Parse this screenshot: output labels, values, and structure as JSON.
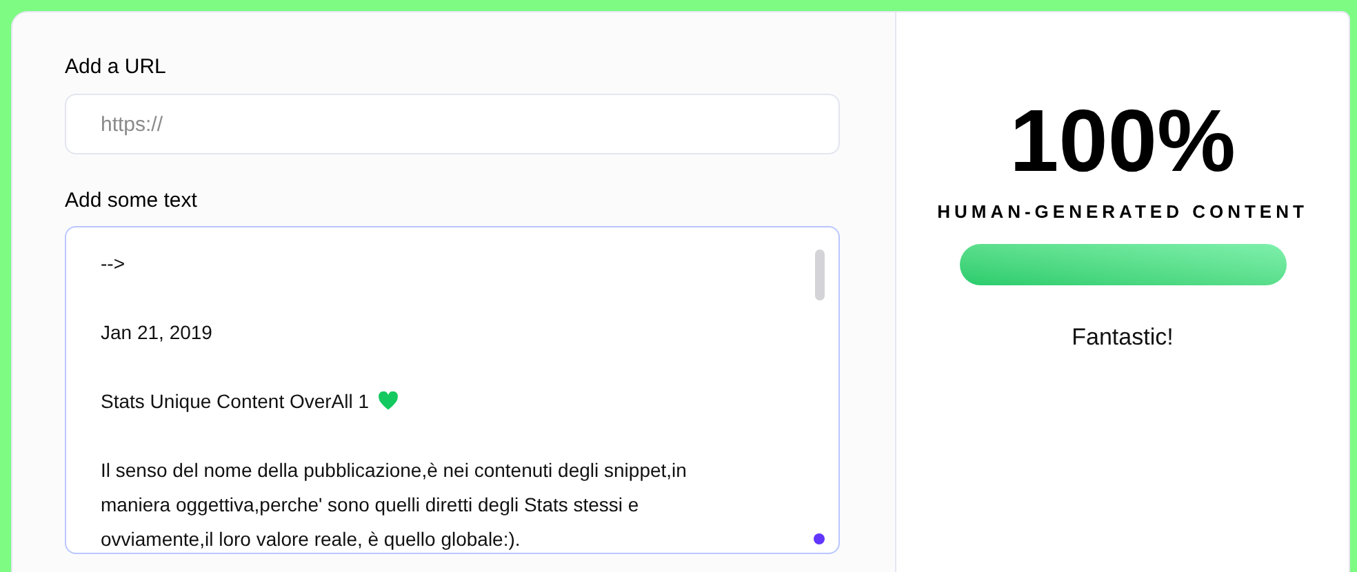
{
  "url_field": {
    "label": "Add a URL",
    "placeholder": "https://"
  },
  "text_field": {
    "label": "Add some text",
    "lines": [
      {
        "text": "-->",
        "heart": false
      },
      {
        "text": "Jan 21, 2019",
        "heart": false
      },
      {
        "text": "Stats Unique Content OverAll 1",
        "heart": true
      },
      {
        "text": "Il senso del nome della pubblicazione,è nei contenuti degli snippet,in maniera oggettiva,perche' sono quelli diretti degli Stats stessi e ovviamente,il loro valore reale, è quello globale:).",
        "heart": false
      }
    ]
  },
  "result": {
    "score": "100%",
    "caption": "HUMAN-GENERATED CONTENT",
    "verdict": "Fantastic!"
  }
}
